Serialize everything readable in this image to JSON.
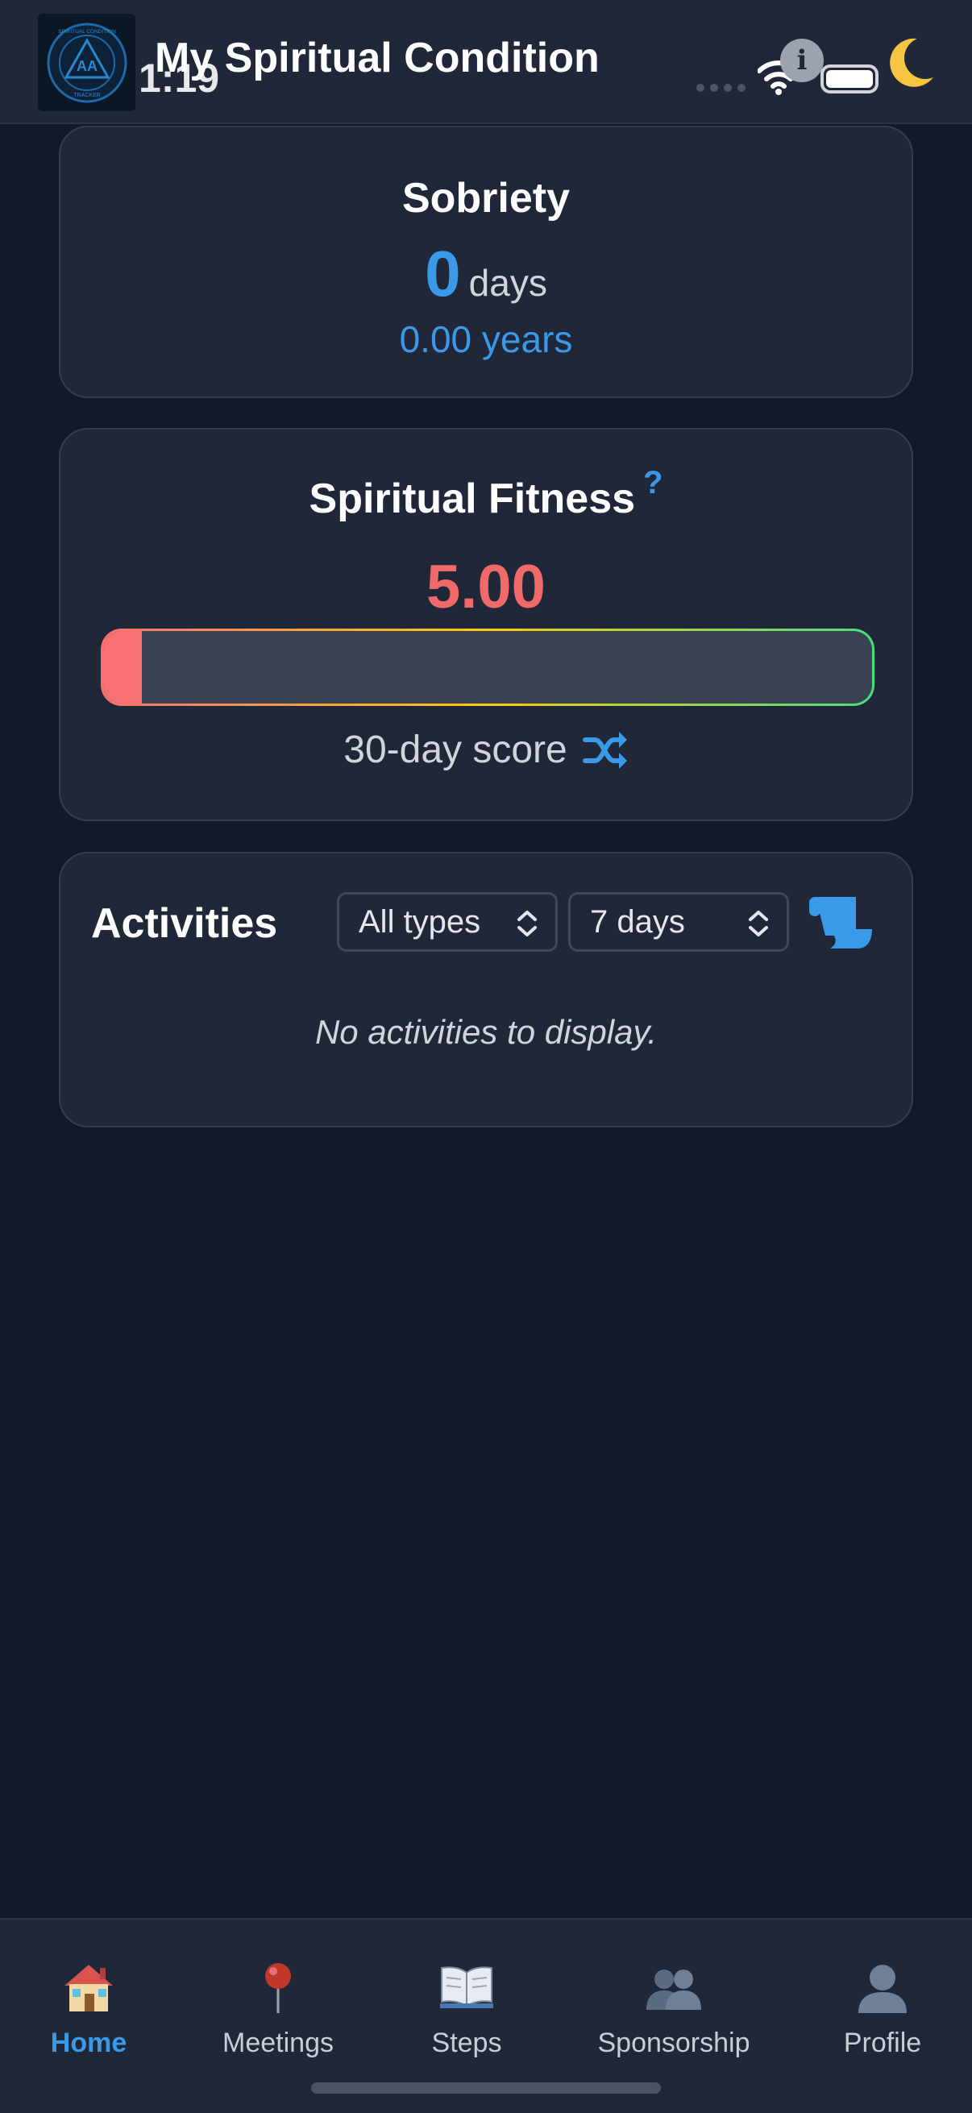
{
  "header": {
    "app_title": "My Spiritual Condition",
    "status_time": "1:19",
    "logo_icon": "aa-triangle-logo-icon",
    "logo_text_top": "SPIRITUAL CONDITION",
    "logo_text_mid": "AA",
    "logo_text_bottom": "TRACKER"
  },
  "status_icons": [
    "signal-dots-icon",
    "wifi-icon",
    "info-icon",
    "battery-icon",
    "moon-icon"
  ],
  "info_glyph": "i",
  "sobriety": {
    "title": "Sobriety",
    "days_value": "0",
    "days_unit": "days",
    "years_text": "0.00 years"
  },
  "fitness": {
    "title": "Spiritual Fitness",
    "help_glyph": "?",
    "score": "5.00",
    "score_fraction": 0.05,
    "caption": "30-day score",
    "shuffle_icon": "shuffle-icon"
  },
  "activities": {
    "title": "Activities",
    "type_filter": {
      "selected": "All types"
    },
    "range_filter": {
      "selected": "7 days"
    },
    "log_icon": "scroll-icon",
    "empty_message": "No activities to display."
  },
  "nav": [
    {
      "label": "Home",
      "icon": "house-icon",
      "active": true
    },
    {
      "label": "Meetings",
      "icon": "pushpin-icon",
      "active": false
    },
    {
      "label": "Steps",
      "icon": "open-book-icon",
      "active": false
    },
    {
      "label": "Sponsorship",
      "icon": "two-people-icon",
      "active": false
    },
    {
      "label": "Profile",
      "icon": "person-icon",
      "active": false
    }
  ],
  "colors": {
    "accent": "#3b9ae8",
    "score_low": "#f06a6a",
    "background": "#121827",
    "card": "#1f2738"
  }
}
